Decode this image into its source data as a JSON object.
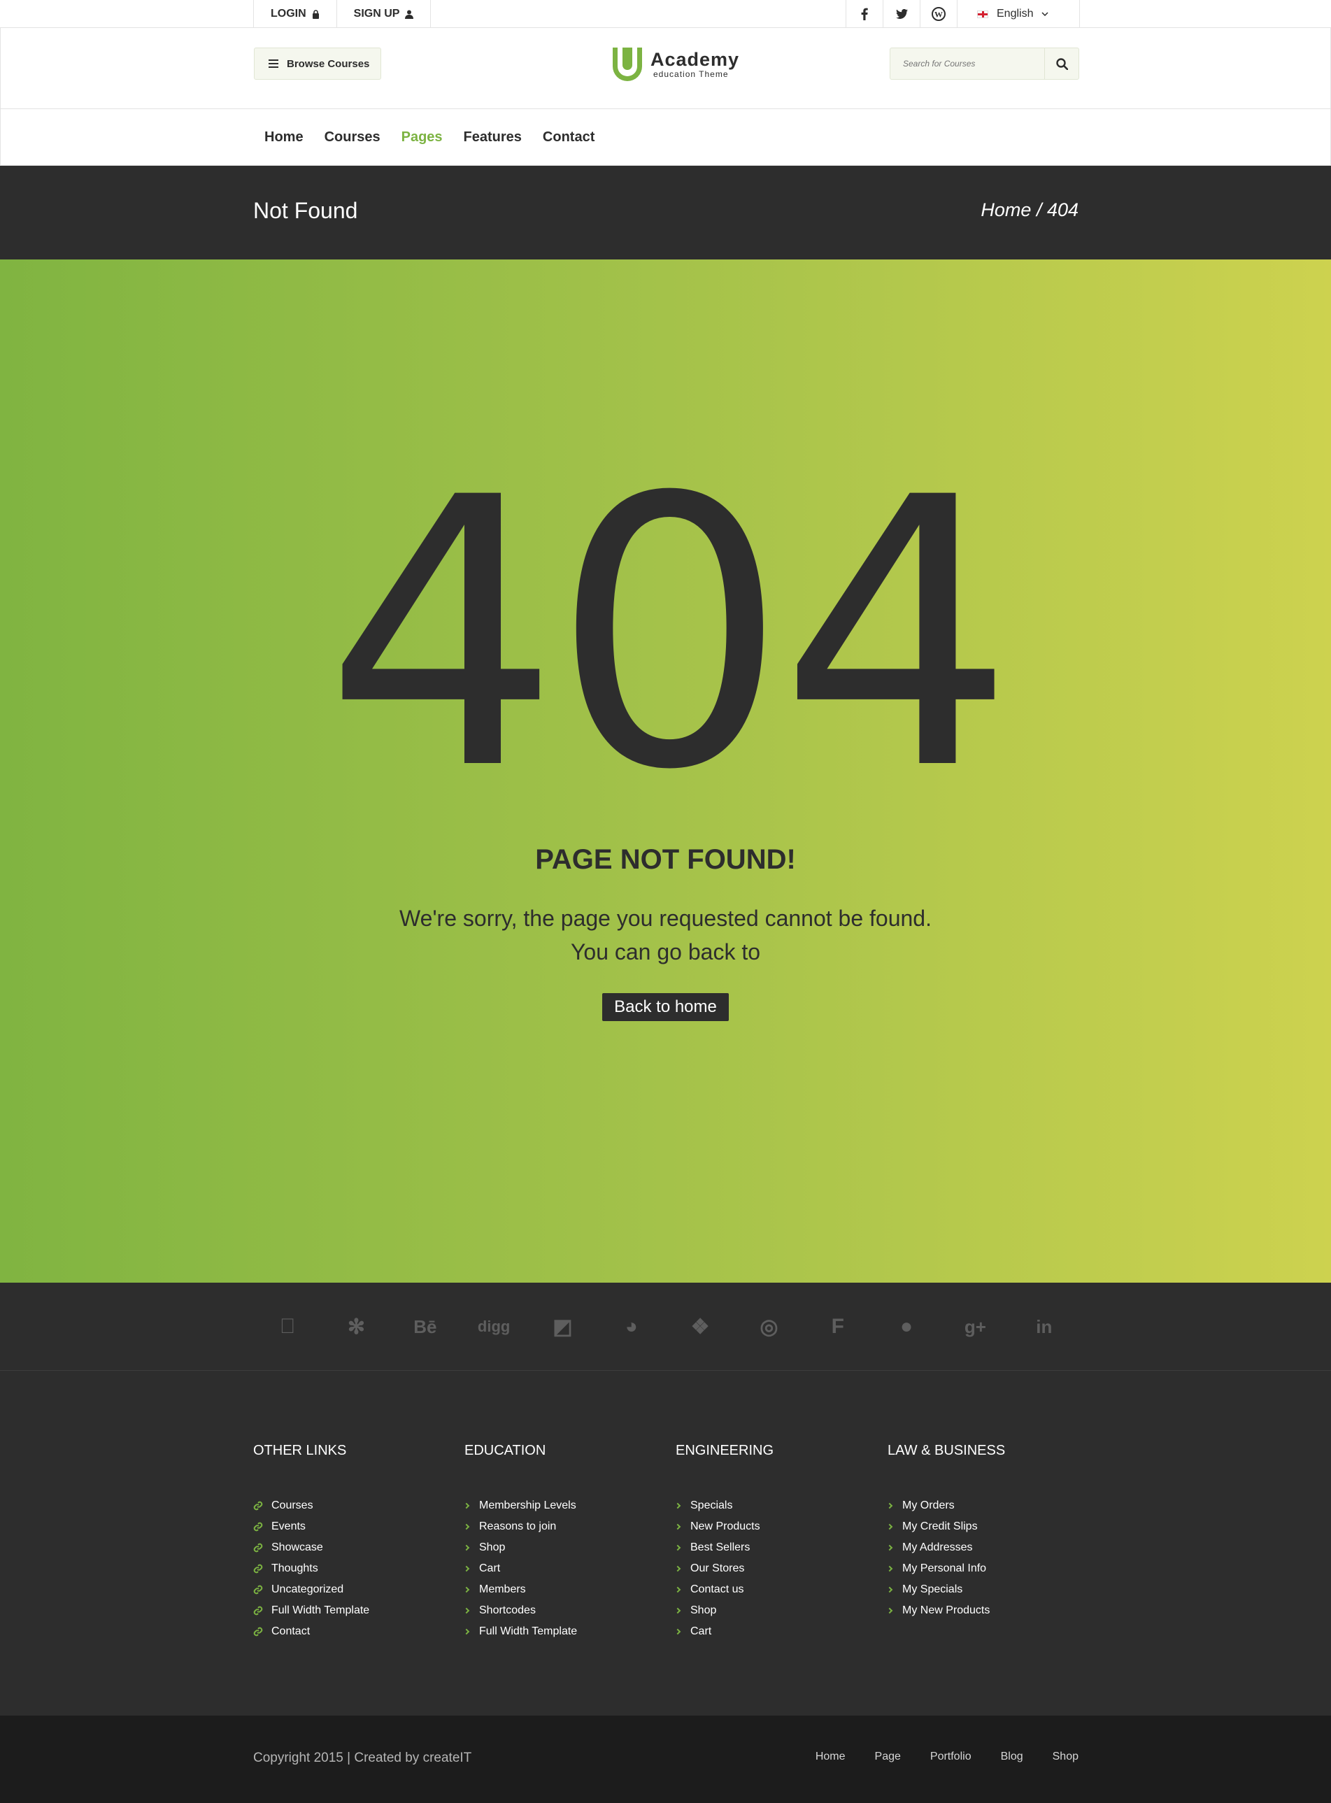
{
  "topbar": {
    "login": "LOGIN",
    "signup": "SIGN UP",
    "social": [
      {
        "icon": "facebook-icon",
        "glyph": "f"
      },
      {
        "icon": "twitter-icon",
        "glyph": "t"
      },
      {
        "icon": "wordpress-icon",
        "glyph": "W"
      }
    ],
    "language": "English"
  },
  "header": {
    "browse_label": "Browse Courses",
    "logo_title": "Academy",
    "logo_subtitle": "education Theme",
    "search_placeholder": "Search for Courses"
  },
  "nav": {
    "items": [
      "Home",
      "Courses",
      "Pages",
      "Features",
      "Contact"
    ],
    "active": "Pages"
  },
  "titlebar": {
    "title": "Not Found",
    "breadcrumb": "Home / 404"
  },
  "hero": {
    "code": "404",
    "heading": "PAGE NOT FOUND!",
    "line1": "We're sorry, the page you requested cannot be found.",
    "line2": "You can go back to",
    "button": "Back to home"
  },
  "social_strip": [
    {
      "icon": "apple-icon",
      "glyph": ""
    },
    {
      "icon": "yelp-icon",
      "glyph": "✻"
    },
    {
      "icon": "behance-icon",
      "glyph": "Bē"
    },
    {
      "icon": "digg-icon",
      "glyph": "digg"
    },
    {
      "icon": "delicious-icon",
      "glyph": "◩"
    },
    {
      "icon": "drupal-icon",
      "glyph": "◕"
    },
    {
      "icon": "dropbox-icon",
      "glyph": "❖"
    },
    {
      "icon": "dribbble-icon",
      "glyph": "◎"
    },
    {
      "icon": "foursquare-icon",
      "glyph": "F"
    },
    {
      "icon": "github-icon",
      "glyph": "●"
    },
    {
      "icon": "google-plus-icon",
      "glyph": "g+"
    },
    {
      "icon": "linkedin-icon",
      "glyph": "in"
    }
  ],
  "footer": {
    "columns": [
      {
        "title": "OTHER LINKS",
        "bullet": "link-icon",
        "items": [
          "Courses",
          "Events",
          "Showcase",
          "Thoughts",
          "Uncategorized",
          "Full Width Template",
          "Contact"
        ]
      },
      {
        "title": "EDUCATION",
        "bullet": "chevron-right-icon",
        "items": [
          "Membership Levels",
          "Reasons to join",
          "Shop",
          "Cart",
          "Members",
          "Shortcodes",
          "Full Width Template"
        ]
      },
      {
        "title": "ENGINEERING",
        "bullet": "chevron-right-icon",
        "items": [
          "Specials",
          "New Products",
          "Best Sellers",
          "Our Stores",
          "Contact us",
          "Shop",
          "Cart"
        ]
      },
      {
        "title": "LAW & BUSINESS",
        "bullet": "chevron-right-icon",
        "items": [
          "My Orders",
          "My Credit Slips",
          "My Addresses",
          "My Personal Info",
          "My Specials",
          "My New Products"
        ]
      }
    ]
  },
  "bottom": {
    "copyright": "Copyright 2015  |  Created by createIT",
    "links": [
      "Home",
      "Page",
      "Portfolio",
      "Blog",
      "Shop"
    ]
  },
  "colors": {
    "accent": "#7cb342",
    "dark": "#2d2d2d",
    "hero_gradient_start": "#80b441",
    "hero_gradient_end": "#cdd24f"
  }
}
